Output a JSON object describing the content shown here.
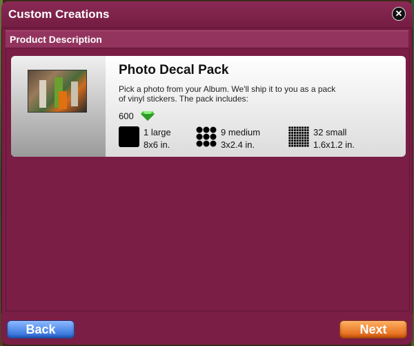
{
  "window": {
    "title": "Custom Creations",
    "close_glyph": "✕"
  },
  "section": {
    "header": "Product Description"
  },
  "product": {
    "title": "Photo Decal Pack",
    "description": "Pick a photo from your Album. We'll ship it to you as a pack of vinyl stickers. The pack includes:",
    "price": "600",
    "currency_icon": "green-gem-icon",
    "sizes": [
      {
        "count_label": "1 large",
        "dimensions": "8x6 in.",
        "icon": "large-square-icon"
      },
      {
        "count_label": "9 medium",
        "dimensions": "3x2.4 in.",
        "icon": "medium-grid-icon"
      },
      {
        "count_label": "32 small",
        "dimensions": "1.6x1.2 in.",
        "icon": "small-grid-icon"
      }
    ]
  },
  "buttons": {
    "back": "Back",
    "next": "Next"
  },
  "colors": {
    "window_bg": "#7a1e45",
    "back_button": "#2a6ad8",
    "next_button": "#e06010",
    "gem": "#4cc43c"
  }
}
